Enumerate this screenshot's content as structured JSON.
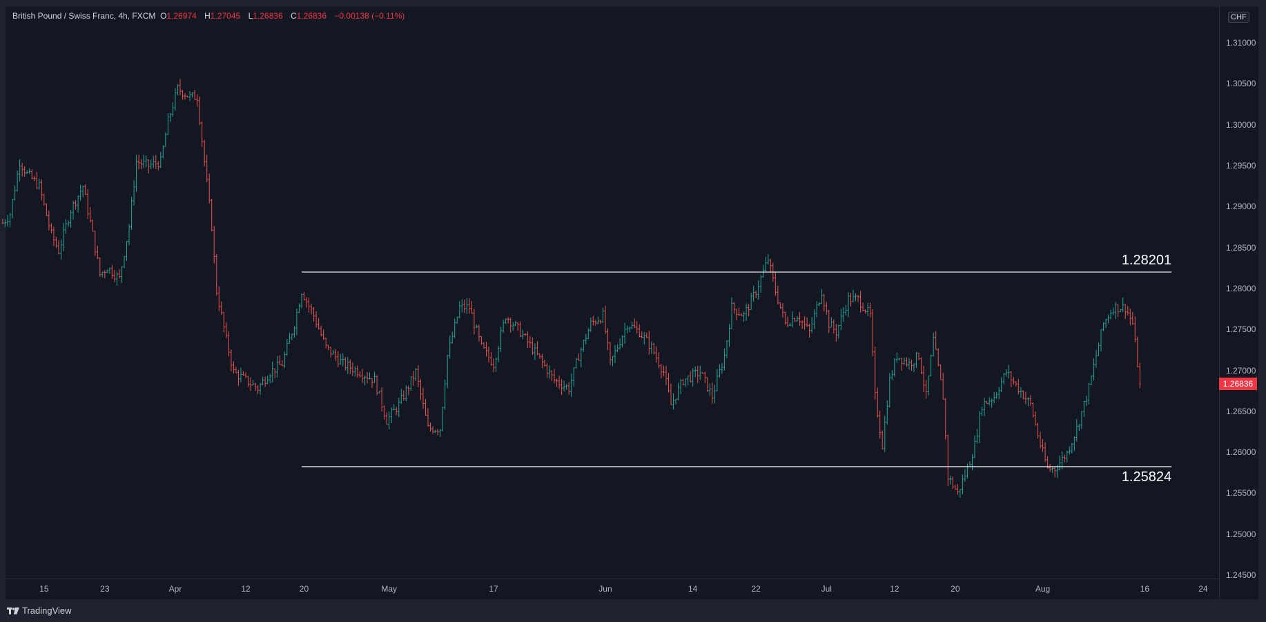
{
  "header": {
    "symbol": "British Pound / Swiss Franc, 4h, FXCM",
    "open_label": "O",
    "open": "1.26974",
    "high_label": "H",
    "high": "1.27045",
    "low_label": "L",
    "low": "1.26836",
    "close_label": "C",
    "close": "1.26836",
    "change": "−0.00138 (−0.11%)"
  },
  "currency": "CHF",
  "last_price": "1.26836",
  "footer": {
    "brand": "TradingView"
  },
  "colors": {
    "up": "#26a69a",
    "down": "#ef5350",
    "background": "#131722",
    "last_price": "#f23645"
  },
  "chart_data": {
    "type": "ohlc",
    "title": "British Pound / Swiss Franc, 4h, FXCM",
    "ylim": [
      1.245,
      1.3125
    ],
    "y_ticks": [
      "1.31000",
      "1.30500",
      "1.30000",
      "1.29500",
      "1.29000",
      "1.28500",
      "1.28000",
      "1.27500",
      "1.27000",
      "1.26500",
      "1.26000",
      "1.25500",
      "1.25000",
      "1.24500"
    ],
    "x_ticks": [
      {
        "label": "15",
        "bar": 17
      },
      {
        "label": "23",
        "bar": 42
      },
      {
        "label": "Apr",
        "bar": 71
      },
      {
        "label": "12",
        "bar": 100
      },
      {
        "label": "20",
        "bar": 124
      },
      {
        "label": "May",
        "bar": 159
      },
      {
        "label": "17",
        "bar": 202
      },
      {
        "label": "Jun",
        "bar": 248
      },
      {
        "label": "14",
        "bar": 284
      },
      {
        "label": "22",
        "bar": 310
      },
      {
        "label": "Jul",
        "bar": 339
      },
      {
        "label": "12",
        "bar": 367
      },
      {
        "label": "20",
        "bar": 392
      },
      {
        "label": "Aug",
        "bar": 428
      },
      {
        "label": "16",
        "bar": 470
      },
      {
        "label": "24",
        "bar": 494
      }
    ],
    "levels": [
      {
        "value": 1.28201,
        "label": "1.28201",
        "from_bar": 123,
        "to_bar": 481
      },
      {
        "value": 1.25824,
        "label": "1.25824",
        "from_bar": 123,
        "to_bar": 481
      }
    ],
    "approx_close_path": [
      [
        0,
        1.288
      ],
      [
        3,
        1.2891
      ],
      [
        7,
        1.2955
      ],
      [
        10,
        1.294
      ],
      [
        15,
        1.2925
      ],
      [
        20,
        1.2866
      ],
      [
        23,
        1.2846
      ],
      [
        28,
        1.2896
      ],
      [
        33,
        1.2925
      ],
      [
        37,
        1.2866
      ],
      [
        40,
        1.2817
      ],
      [
        43,
        1.2826
      ],
      [
        48,
        1.2812
      ],
      [
        52,
        1.2876
      ],
      [
        55,
        1.2955
      ],
      [
        60,
        1.295
      ],
      [
        65,
        1.2955
      ],
      [
        68,
        1.3004
      ],
      [
        72,
        1.3044
      ],
      [
        77,
        1.3034
      ],
      [
        80,
        1.3034
      ],
      [
        83,
        1.2955
      ],
      [
        86,
        1.2876
      ],
      [
        88,
        1.2797
      ],
      [
        92,
        1.2737
      ],
      [
        95,
        1.2698
      ],
      [
        100,
        1.2688
      ],
      [
        105,
        1.2678
      ],
      [
        110,
        1.2698
      ],
      [
        115,
        1.2708
      ],
      [
        120,
        1.2757
      ],
      [
        123,
        1.2797
      ],
      [
        128,
        1.2767
      ],
      [
        133,
        1.2728
      ],
      [
        140,
        1.2708
      ],
      [
        147,
        1.2698
      ],
      [
        153,
        1.2688
      ],
      [
        158,
        1.2639
      ],
      [
        163,
        1.2658
      ],
      [
        170,
        1.2698
      ],
      [
        175,
        1.2629
      ],
      [
        180,
        1.2629
      ],
      [
        183,
        1.2718
      ],
      [
        188,
        1.2777
      ],
      [
        192,
        1.2777
      ],
      [
        197,
        1.2728
      ],
      [
        202,
        1.2708
      ],
      [
        207,
        1.2767
      ],
      [
        213,
        1.2747
      ],
      [
        220,
        1.2718
      ],
      [
        227,
        1.2688
      ],
      [
        233,
        1.2678
      ],
      [
        237,
        1.2718
      ],
      [
        242,
        1.2757
      ],
      [
        247,
        1.2767
      ],
      [
        250,
        1.2708
      ],
      [
        257,
        1.2757
      ],
      [
        262,
        1.2747
      ],
      [
        267,
        1.2728
      ],
      [
        272,
        1.2698
      ],
      [
        275,
        1.2658
      ],
      [
        280,
        1.2688
      ],
      [
        287,
        1.2698
      ],
      [
        292,
        1.2668
      ],
      [
        297,
        1.2718
      ],
      [
        300,
        1.2777
      ],
      [
        305,
        1.2767
      ],
      [
        310,
        1.2797
      ],
      [
        315,
        1.2836
      ],
      [
        318,
        1.2797
      ],
      [
        322,
        1.2757
      ],
      [
        327,
        1.2767
      ],
      [
        332,
        1.2747
      ],
      [
        337,
        1.2797
      ],
      [
        340,
        1.2757
      ],
      [
        343,
        1.2747
      ],
      [
        348,
        1.2787
      ],
      [
        352,
        1.2787
      ],
      [
        357,
        1.2767
      ],
      [
        359,
        1.2668
      ],
      [
        362,
        1.2609
      ],
      [
        365,
        1.2688
      ],
      [
        368,
        1.2718
      ],
      [
        373,
        1.2708
      ],
      [
        377,
        1.2718
      ],
      [
        380,
        1.2668
      ],
      [
        383,
        1.2737
      ],
      [
        387,
        1.2668
      ],
      [
        389,
        1.257
      ],
      [
        393,
        1.255
      ],
      [
        397,
        1.258
      ],
      [
        400,
        1.2609
      ],
      [
        403,
        1.2658
      ],
      [
        408,
        1.2668
      ],
      [
        413,
        1.2698
      ],
      [
        418,
        1.2678
      ],
      [
        423,
        1.2658
      ],
      [
        427,
        1.2609
      ],
      [
        430,
        1.258
      ],
      [
        433,
        1.258
      ],
      [
        438,
        1.2599
      ],
      [
        442,
        1.2629
      ],
      [
        447,
        1.2678
      ],
      [
        450,
        1.2718
      ],
      [
        453,
        1.2757
      ],
      [
        457,
        1.2777
      ],
      [
        462,
        1.2777
      ],
      [
        465,
        1.2757
      ],
      [
        468,
        1.26836
      ]
    ]
  }
}
